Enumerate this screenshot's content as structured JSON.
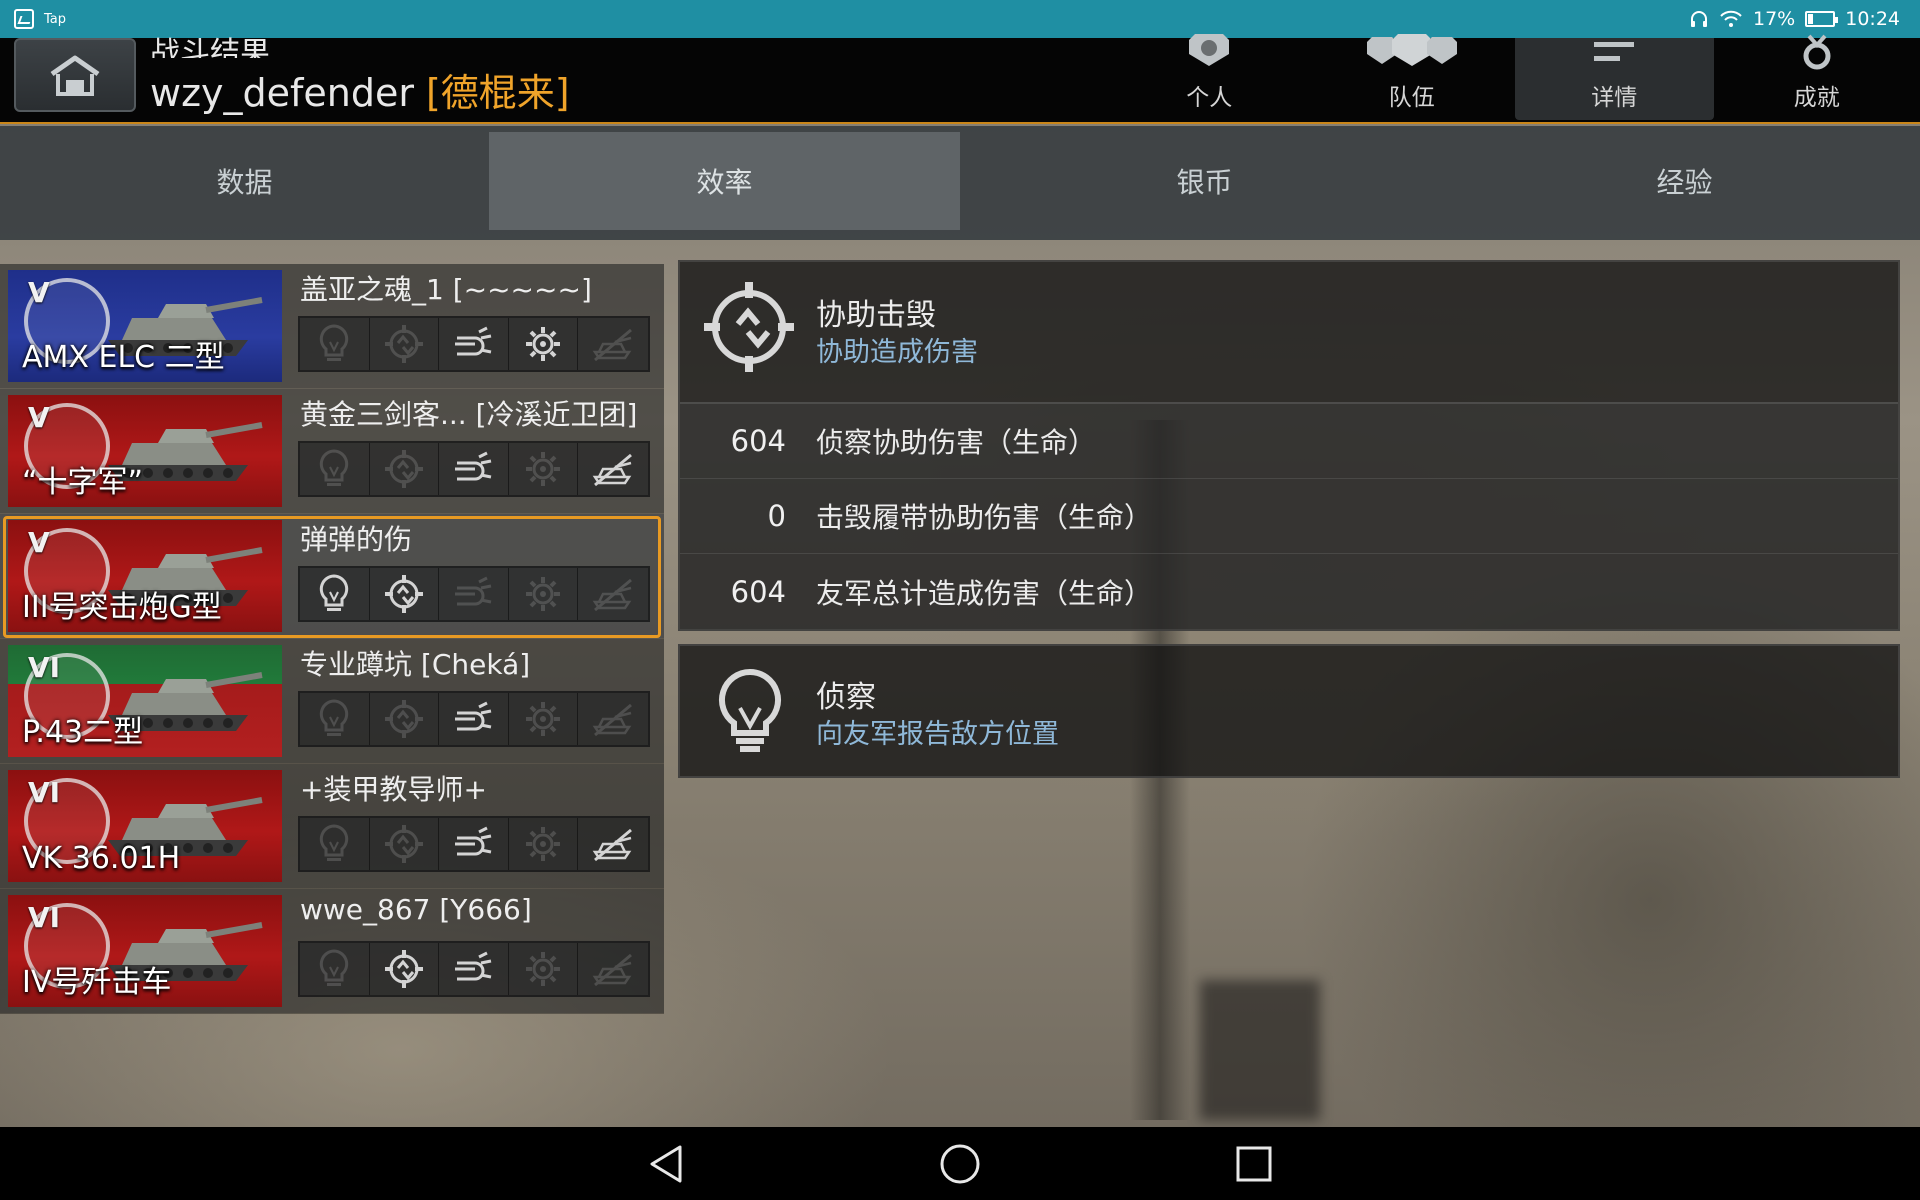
{
  "status_bar": {
    "notification_label": "Tap",
    "battery_percent": "17%",
    "battery_level": 0.17,
    "time": "10:24"
  },
  "header": {
    "subtitle": "战斗结果",
    "player_name": "wzy_defender",
    "clan_tag": "[德棍来]",
    "tabs": [
      {
        "label": "个人",
        "icon": "person-badge-icon"
      },
      {
        "label": "队伍",
        "icon": "team-badge-icon"
      },
      {
        "label": "详情",
        "icon": "details-list-icon",
        "active": true
      },
      {
        "label": "成就",
        "icon": "medal-icon"
      }
    ]
  },
  "subtabs": [
    {
      "label": "数据"
    },
    {
      "label": "效率",
      "active": true
    },
    {
      "label": "银币"
    },
    {
      "label": "经验"
    }
  ],
  "players": [
    {
      "vehicle": "AMX ELC 二型",
      "tier": "V",
      "flag": "france",
      "player": "盖亚之魂_1 [~~~~~]",
      "medals": [
        false,
        false,
        true,
        true,
        false
      ]
    },
    {
      "vehicle": "“十字军”",
      "tier": "V",
      "flag": "uk",
      "player": "黄金三剑客...  [冷溪近卫团]",
      "medals": [
        false,
        false,
        true,
        false,
        true
      ]
    },
    {
      "vehicle": "III号突击炮G型",
      "tier": "V",
      "flag": "germany",
      "player": "弹弹的伤",
      "selected": true,
      "medals": [
        true,
        true,
        false,
        false,
        false
      ]
    },
    {
      "vehicle": "P.43二型",
      "tier": "VI",
      "flag": "italy",
      "player": "专业蹲坑 [Cheká]",
      "medals": [
        false,
        false,
        true,
        false,
        false
      ]
    },
    {
      "vehicle": "VK 36.01H",
      "tier": "VI",
      "flag": "germany",
      "player": "+装甲教导师+",
      "medals": [
        false,
        false,
        true,
        false,
        true
      ]
    },
    {
      "vehicle": "IV号歼击车",
      "tier": "VI",
      "flag": "germany",
      "player": "wwe_867 [Y666]",
      "medals": [
        false,
        true,
        true,
        false,
        false
      ]
    }
  ],
  "medal_icons": [
    "spotting-bulb-icon",
    "assist-target-icon",
    "damage-shell-icon",
    "gear-icon",
    "tank-destroyed-icon"
  ],
  "assist_panel": {
    "title": "协助击毁",
    "subtitle": "协助造成伤害",
    "stats": [
      {
        "value": "604",
        "label": "侦察协助伤害（生命）"
      },
      {
        "value": "0",
        "label": "击毁履带协助伤害（生命）"
      },
      {
        "value": "604",
        "label": "友军总计造成伤害（生命）"
      }
    ]
  },
  "spot_panel": {
    "title": "侦察",
    "subtitle": "向友军报告敌方位置"
  },
  "colors": {
    "accent": "#e89a23",
    "status_bar": "#1f8fa3",
    "subtitle_blue": "#8fb8d8",
    "clan_tag": "#f0a42a"
  }
}
